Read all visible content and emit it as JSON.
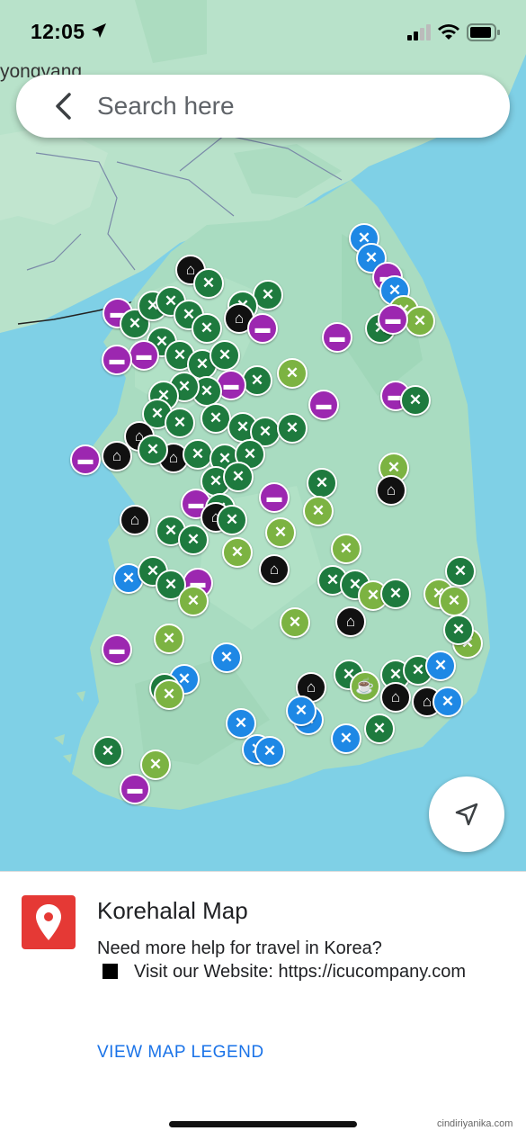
{
  "status_bar": {
    "time": "12:05"
  },
  "search": {
    "placeholder": "Search here"
  },
  "map": {
    "city_label": "yongyang"
  },
  "panel": {
    "app_title": "Korehalal Map",
    "description_line1": "Need more help for travel in Korea?",
    "description_line2": "Visit our Website: https://icucompany.com",
    "legend_link": "VIEW MAP LEGEND"
  },
  "credit": "cindiriyanika.com",
  "colors": {
    "water": "#7fd0e6",
    "land_north": "#b7e1c9",
    "land_south": "#a8dcc0",
    "app_icon": "#e53935",
    "link": "#1a73e8",
    "marker_dark_green": "#1e7a3e",
    "marker_light_green": "#7cb342",
    "marker_blue": "#1e88e5",
    "marker_purple": "#9c27b0",
    "marker_black": "#111111"
  },
  "marker_icons": {
    "restaurant": "fork-knife-icon",
    "hotel": "bed-icon",
    "mosque": "mosque-icon",
    "cafe": "cup-icon"
  }
}
